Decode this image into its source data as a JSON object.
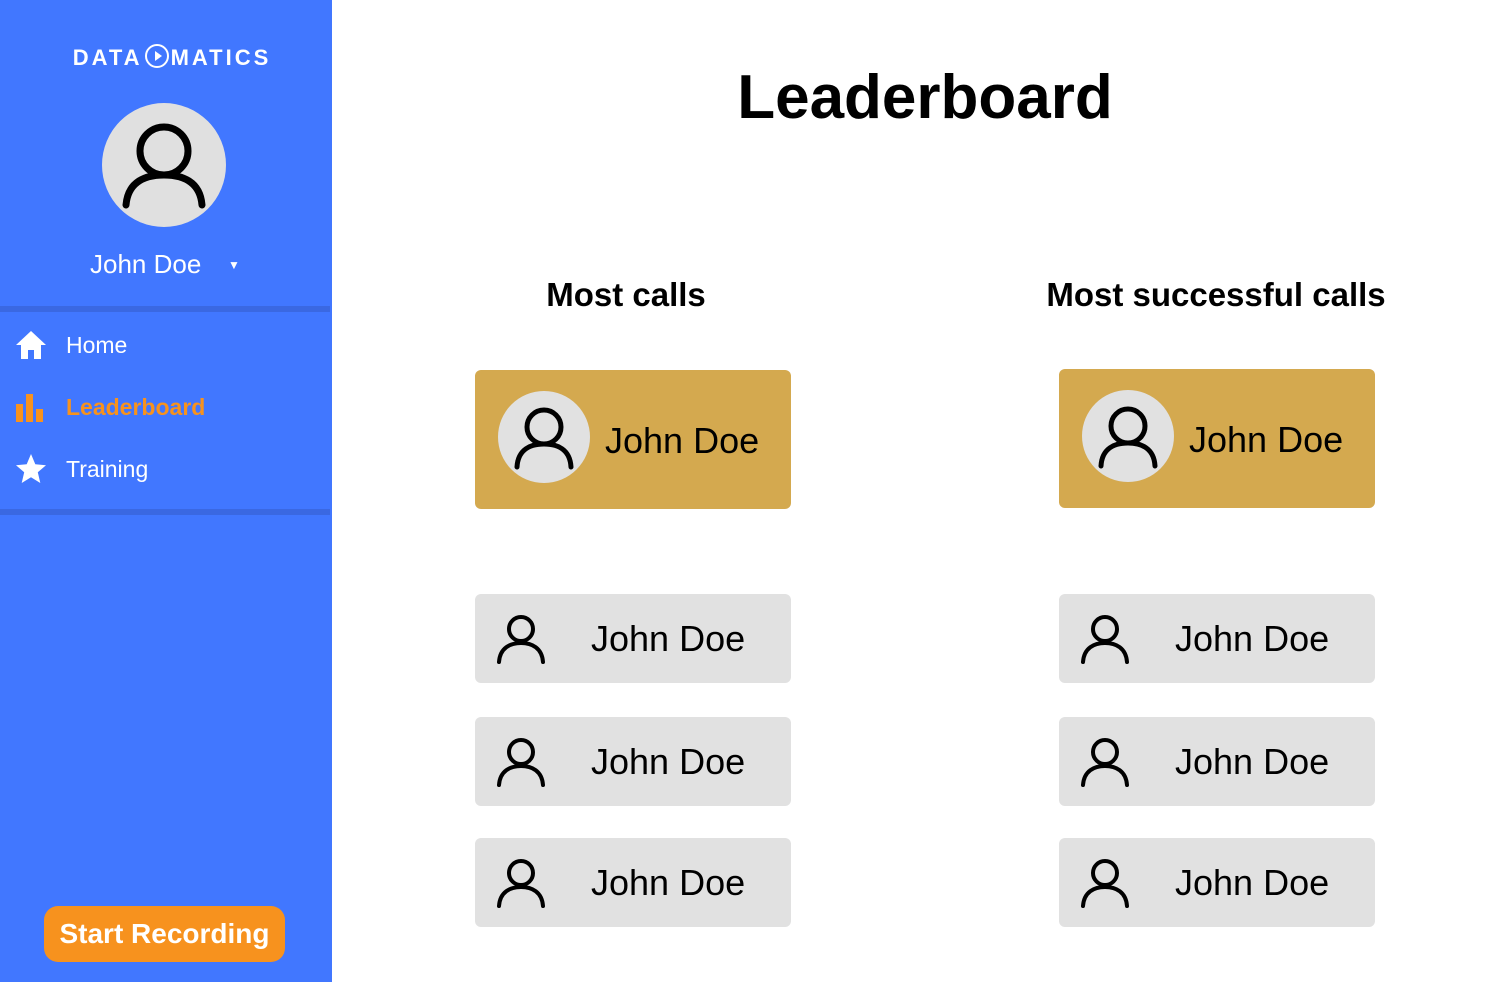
{
  "brand": {
    "logo_left": "DATA",
    "logo_right": "MATICS",
    "primary_color": "#4177ff",
    "accent_color": "#f7921e",
    "gold_color": "#d4a94f"
  },
  "user": {
    "name": "John Doe",
    "caret": "▼",
    "avatar_icon": "user-icon"
  },
  "sidebar": {
    "items": [
      {
        "label": "Home",
        "icon": "home-icon",
        "active": false
      },
      {
        "label": "Leaderboard",
        "icon": "bar-chart-icon",
        "active": true
      },
      {
        "label": "Training",
        "icon": "star-icon",
        "active": false
      }
    ],
    "record_button": "Start Recording"
  },
  "main": {
    "title": "Leaderboard",
    "columns": [
      {
        "title": "Most calls",
        "top": {
          "name": "John Doe"
        },
        "rest": [
          {
            "name": "John Doe"
          },
          {
            "name": "John Doe"
          },
          {
            "name": "John Doe"
          }
        ]
      },
      {
        "title": "Most successful calls",
        "top": {
          "name": "John Doe"
        },
        "rest": [
          {
            "name": "John Doe"
          },
          {
            "name": "John Doe"
          },
          {
            "name": "John Doe"
          }
        ]
      }
    ]
  }
}
